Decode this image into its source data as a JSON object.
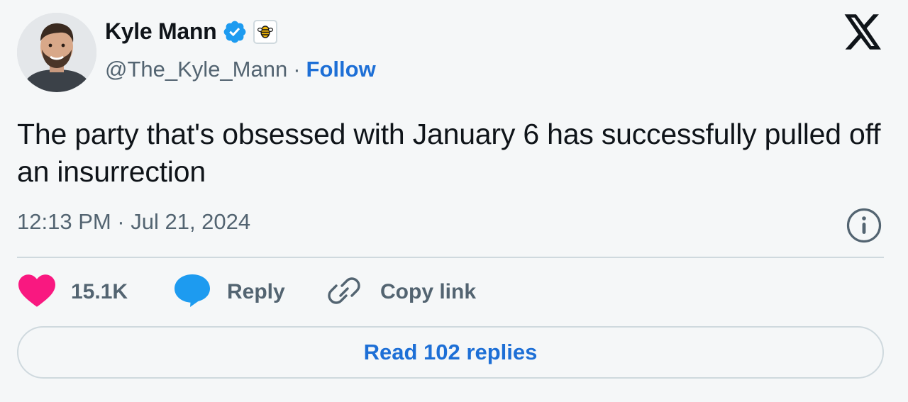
{
  "author": {
    "name": "Kyle Mann",
    "handle": "@The_Kyle_Mann",
    "separator": "·",
    "follow_label": "Follow",
    "avatar_icon": "profile-photo",
    "verified_icon": "verified-badge-icon",
    "affiliate_icon": "bee-logo-icon"
  },
  "tweet": {
    "text": "The party that's obsessed with January 6 has successfully pulled off an insurrection",
    "timestamp": "12:13 PM · Jul 21, 2024"
  },
  "actions": {
    "like_count": "15.1K",
    "reply_label": "Reply",
    "copy_link_label": "Copy link"
  },
  "footer": {
    "read_replies_label": "Read 102 replies"
  },
  "colors": {
    "background": "#f5f7f8",
    "accent": "#1d6fd6",
    "like": "#f91880",
    "reply_bubble": "#1d9bf0",
    "secondary_text": "#536471",
    "border": "#cfd9de"
  }
}
